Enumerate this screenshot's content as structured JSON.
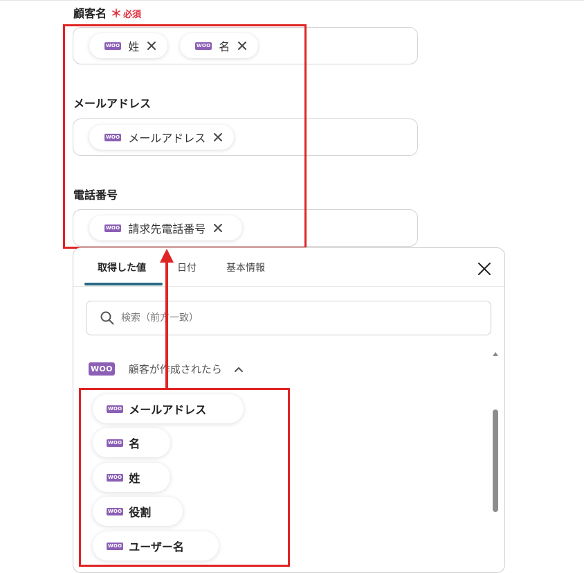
{
  "form": {
    "customer_name": {
      "label": "顧客名",
      "required_star": "＊",
      "required_text": "必須",
      "tags": [
        {
          "badge": "WOO",
          "text": "姓"
        },
        {
          "badge": "WOO",
          "text": "名"
        }
      ]
    },
    "email": {
      "label": "メールアドレス",
      "tags": [
        {
          "badge": "WOO",
          "text": "メールアドレス"
        }
      ]
    },
    "phone": {
      "label": "電話番号",
      "tags": [
        {
          "badge": "WOO",
          "text": "請求先電話番号"
        }
      ]
    }
  },
  "panel": {
    "tabs": [
      {
        "label": "取得した値",
        "active": true
      },
      {
        "label": "日付",
        "active": false
      },
      {
        "label": "基本情報",
        "active": false
      }
    ],
    "search": {
      "placeholder": "検索（前方一致）"
    },
    "group": {
      "badge": "WOO",
      "title": "顧客が作成されたら"
    },
    "items": [
      {
        "badge": "WOO",
        "label": "メールアドレス"
      },
      {
        "badge": "WOO",
        "label": "名"
      },
      {
        "badge": "WOO",
        "label": "姓"
      },
      {
        "badge": "WOO",
        "label": "役割"
      },
      {
        "badge": "WOO",
        "label": "ユーザー名"
      }
    ]
  },
  "colors": {
    "highlight": "#e02424",
    "woo_brand": "#8b5fb5",
    "tab_underline": "#2a6a86",
    "required": "#e0303a"
  },
  "icons": {
    "close": "close-icon",
    "remove_tag": "close-icon",
    "search": "search-icon",
    "collapse": "chevron-up-icon",
    "annotation_arrow": "arrow-up-icon"
  }
}
